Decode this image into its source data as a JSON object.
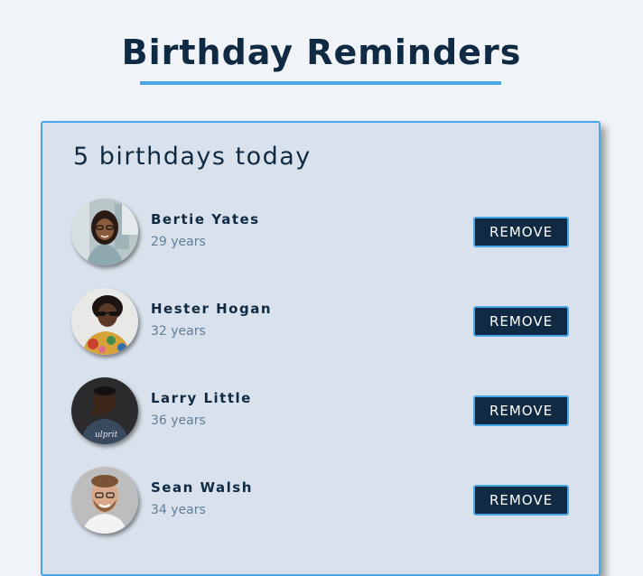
{
  "header": {
    "title": "Birthday Reminders"
  },
  "summary": {
    "count_text": "5 birthdays today"
  },
  "people": [
    {
      "name": "Bertie Yates",
      "age": "29 years",
      "avatar": "avatar-photo-woman-glasses",
      "remove_label": "REMOVE"
    },
    {
      "name": "Hester Hogan",
      "age": "32 years",
      "avatar": "avatar-photo-woman-sunglasses",
      "remove_label": "REMOVE"
    },
    {
      "name": "Larry Little",
      "age": "36 years",
      "avatar": "avatar-photo-man-dark",
      "remove_label": "REMOVE"
    },
    {
      "name": "Sean Walsh",
      "age": "34 years",
      "avatar": "avatar-photo-man-beard",
      "remove_label": "REMOVE"
    }
  ],
  "colors": {
    "background": "#f0f4f8",
    "card": "#d9e2ec",
    "accent": "#49a6e9",
    "primary_dark": "#102a43",
    "muted_text": "#627d98"
  }
}
